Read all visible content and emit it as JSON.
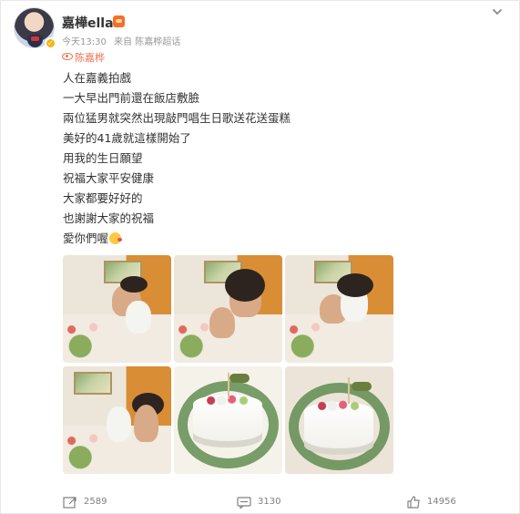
{
  "post": {
    "author": "嘉樺ella",
    "time": "今天13:30",
    "source": "来自 陈嘉桦超话",
    "topic": "陈嘉桦",
    "lines": [
      "人在嘉義拍戲",
      "一大早出門前還在飯店敷臉",
      "兩位猛男就突然出現敲門唱生日歌送花送蛋糕",
      "美好的41歲就這樣開始了",
      "用我的生日願望",
      "祝福大家平安健康",
      "大家都要好好的",
      "也謝謝大家的祝福",
      "愛你們喔"
    ],
    "emoji_icon": "kiss-face-emoji"
  },
  "photos": [
    {
      "icon": "photo-thumbnail"
    },
    {
      "icon": "photo-thumbnail"
    },
    {
      "icon": "photo-thumbnail"
    },
    {
      "icon": "photo-thumbnail"
    },
    {
      "icon": "photo-thumbnail"
    },
    {
      "icon": "photo-thumbnail"
    }
  ],
  "stats": {
    "shares": "2589",
    "comments": "3130",
    "likes": "14956"
  },
  "icons": {
    "share": "share-icon",
    "comment": "comment-icon",
    "like": "thumbs-up-icon",
    "menu": "chevron-down-icon",
    "verified": "verified-badge-icon",
    "topic": "eye-icon"
  },
  "colors": {
    "accent": "#eb7350",
    "verify": "#f6b50e",
    "text": "#333333",
    "muted": "#999999"
  }
}
